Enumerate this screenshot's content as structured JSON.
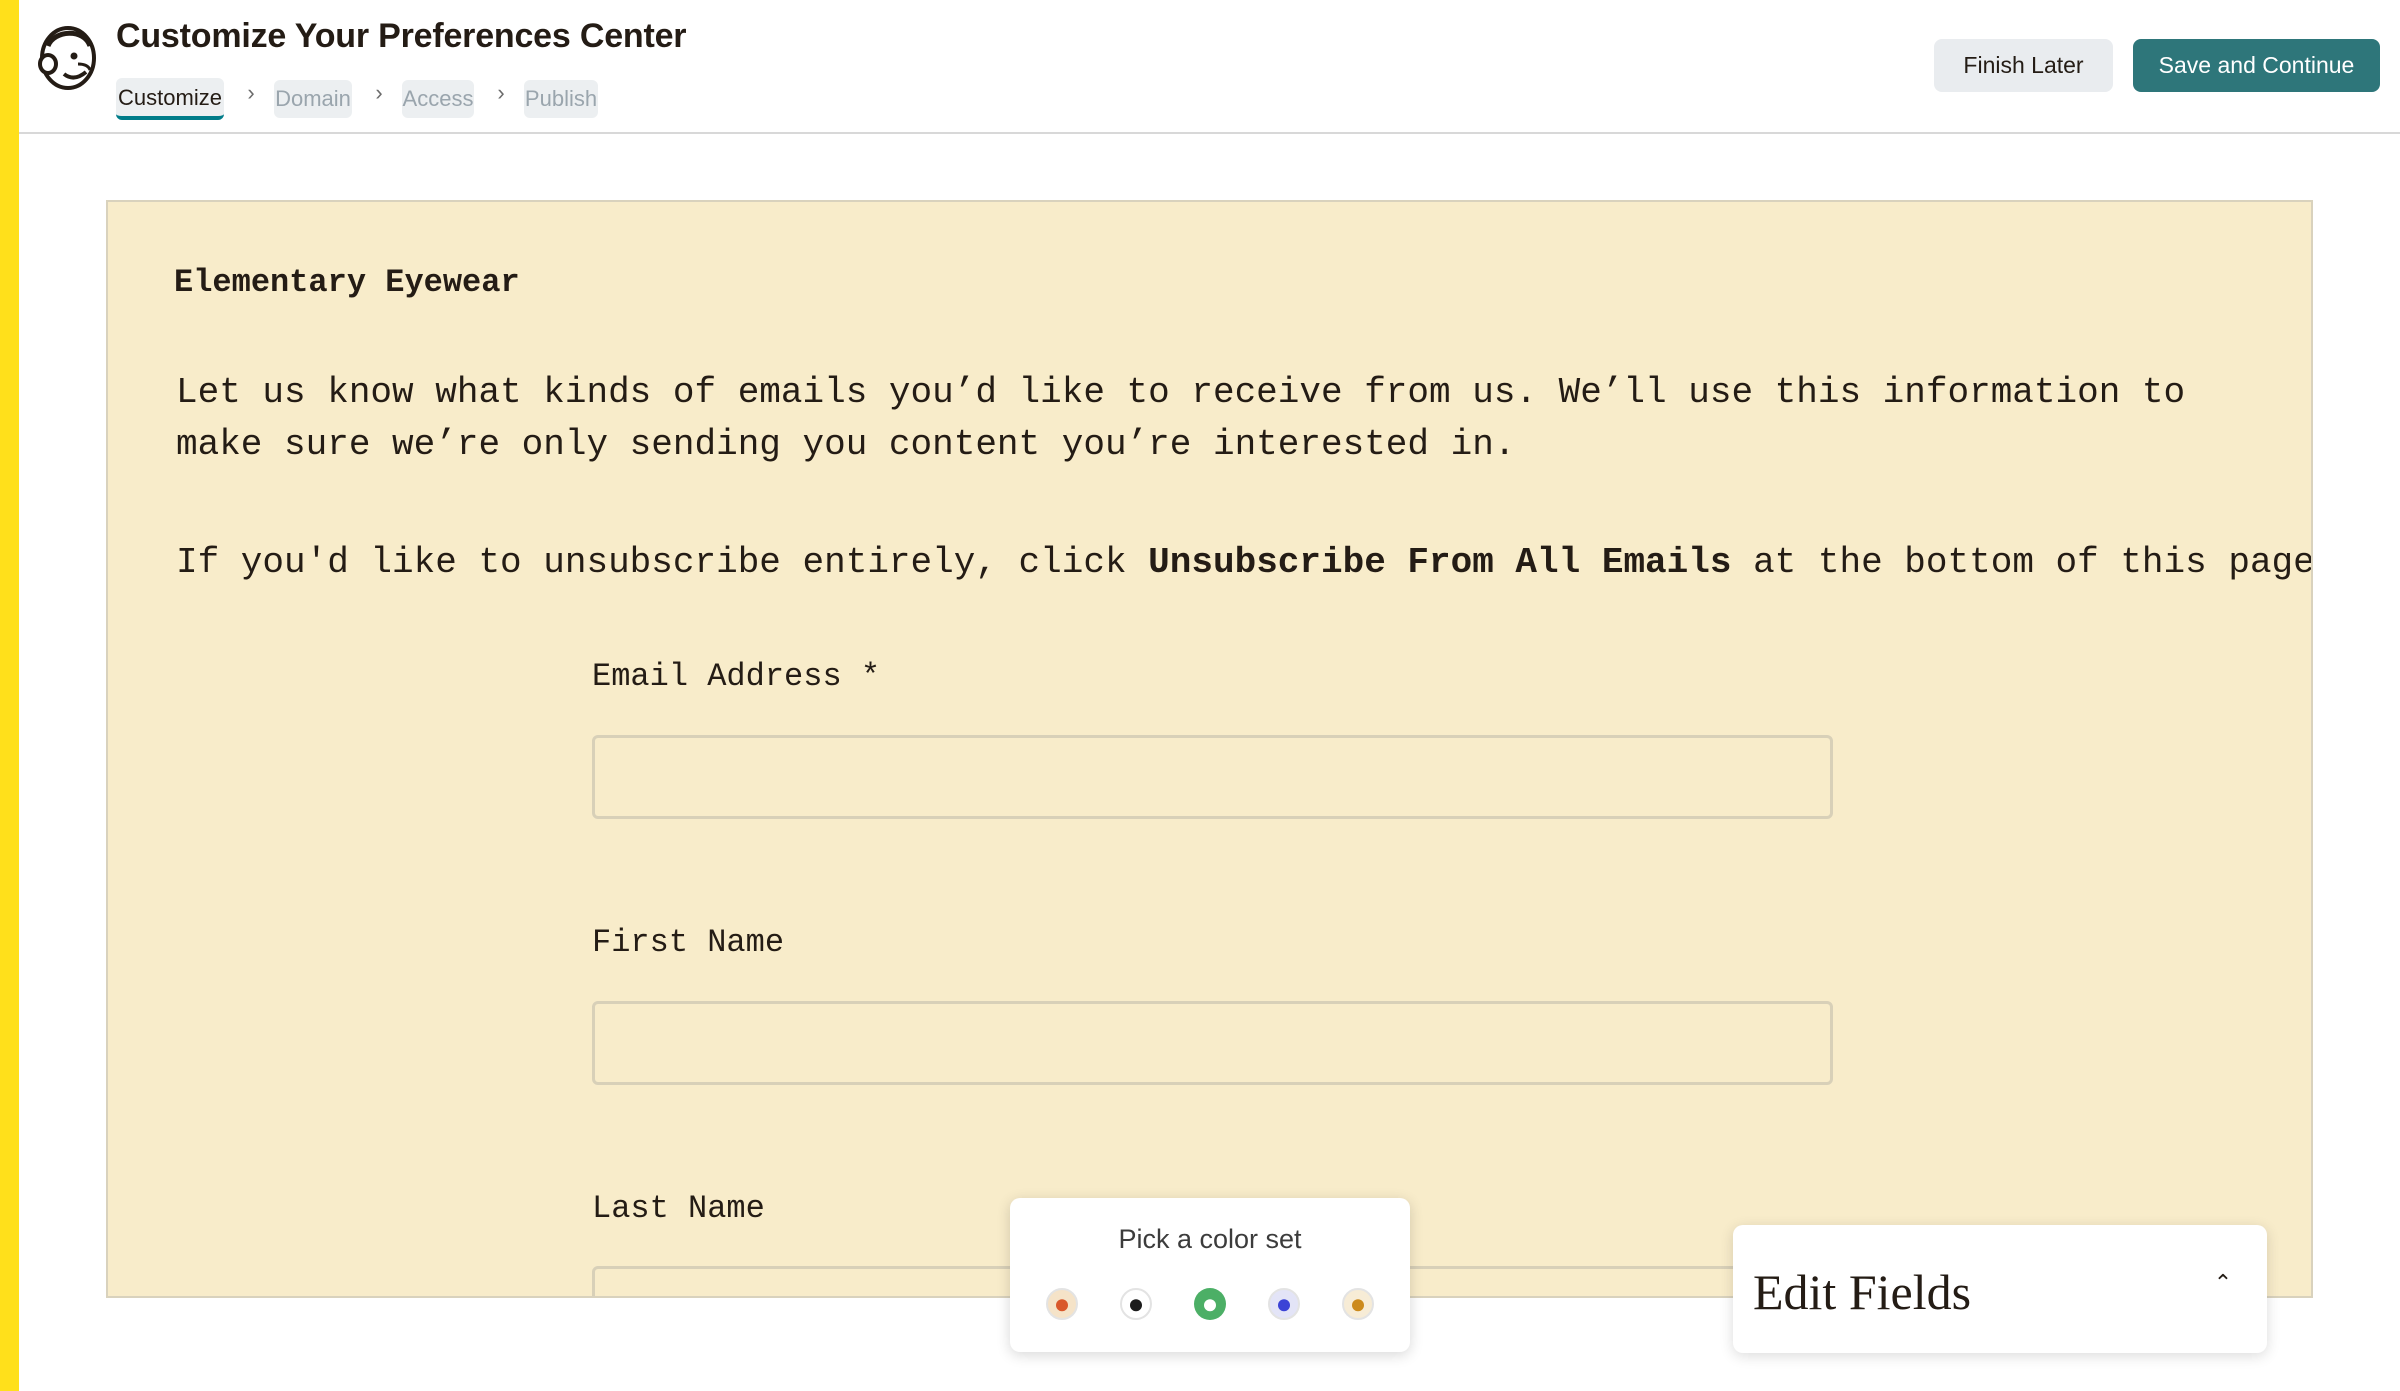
{
  "header": {
    "title": "Customize Your Preferences Center",
    "steps": [
      {
        "label": "Customize",
        "state": "active"
      },
      {
        "label": "Domain",
        "state": "inactive"
      },
      {
        "label": "Access",
        "state": "inactive"
      },
      {
        "label": "Publish",
        "state": "inactive"
      }
    ],
    "finish_later_label": "Finish Later",
    "save_continue_label": "Save and Continue"
  },
  "canvas": {
    "brand": "Elementary Eyewear",
    "intro": "Let us know what kinds of emails you’d like to receive from us. We’ll use this information to make sure we’re only sending you content you’re interested in.",
    "unsubscribe_prefix": "If you'd like to unsubscribe entirely, click ",
    "unsubscribe_bold": "Unsubscribe From All Emails",
    "unsubscribe_suffix": " at the bottom of this page.",
    "fields": [
      {
        "label": "Email Address *",
        "value": ""
      },
      {
        "label": "First Name",
        "value": ""
      },
      {
        "label": "Last Name",
        "value": ""
      }
    ],
    "background_color": "#f8ecca"
  },
  "color_picker": {
    "title": "Pick a color set",
    "swatches": [
      {
        "name": "orange-set",
        "ring": "#f5e3c8",
        "dot": "#d9582b",
        "selected": false
      },
      {
        "name": "black-set",
        "ring": "#ffffff",
        "dot": "#1c1c1c",
        "selected": false
      },
      {
        "name": "green-set",
        "ring": "#4caf66",
        "dot": "#ffffff",
        "selected": true
      },
      {
        "name": "blue-set",
        "ring": "#e3e4f7",
        "dot": "#3b43d6",
        "selected": false
      },
      {
        "name": "gold-set",
        "ring": "#f7ecd6",
        "dot": "#cc8a1c",
        "selected": false
      }
    ]
  },
  "edit_fields": {
    "title": "Edit Fields",
    "icon": "chevron-up-icon"
  },
  "colors": {
    "accent": "#007c89",
    "save_button": "#2e767a",
    "brand_stripe": "#ffe01b"
  }
}
